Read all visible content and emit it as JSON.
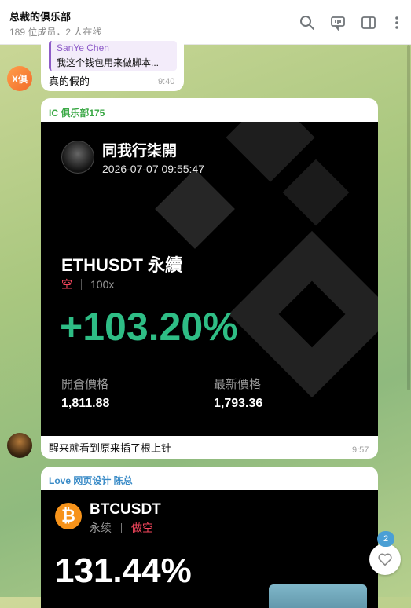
{
  "header": {
    "title": "总裁的俱乐部",
    "subtitle": "189 位成员，2 人在线"
  },
  "msg1": {
    "avatar_text": "X俱",
    "reply_author": "SanYe Chen",
    "reply_text": "我这个钱包用来做脚本...",
    "text": "真的假的",
    "time": "9:40"
  },
  "msg2": {
    "sender": "IC 俱乐部175",
    "card": {
      "user": "同我行柒開",
      "datetime": "2026-07-07 09:55:47",
      "pair": "ETHUSDT 永續",
      "side": "空",
      "leverage": "100x",
      "pnl": "+103.20%",
      "open_label": "開倉價格",
      "open_value": "1,811.88",
      "last_label": "最新價格",
      "last_value": "1,793.36"
    },
    "caption": "醒来就看到原来插了根上针",
    "time": "9:57"
  },
  "msg3": {
    "sender": "Love 网页设计 陈总",
    "card": {
      "coin_symbol": "₿",
      "pair": "BTCUSDT",
      "type": "永续",
      "side": "做空",
      "pnl": "131.44%"
    }
  },
  "reactions": {
    "count": "2"
  },
  "colors": {
    "green": "#2ebd85",
    "red": "#f6465d",
    "sender_green": "#3aa845",
    "sender_blue": "#3a8bc7",
    "reply_purple": "#8e5cc8",
    "btc_orange": "#f7931a"
  }
}
